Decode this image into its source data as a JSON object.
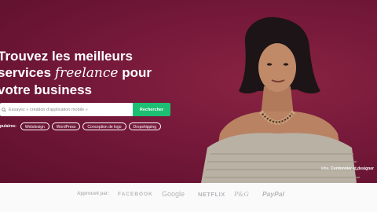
{
  "hero": {
    "title_line1": "Trouvez les meilleurs",
    "title_services": "services",
    "title_italic": "freelance",
    "title_pour": "pour",
    "title_line3": "votre business",
    "background_color": "#76193a"
  },
  "search": {
    "placeholder": "Essayez « création d'application mobile »",
    "button_label": "Rechercher",
    "button_color": "#1dbf73"
  },
  "popular": {
    "label": "pulaires:",
    "chips": [
      "Webdesign",
      "WordPress",
      "Conception de logo",
      "Dropshipping"
    ]
  },
  "caption": {
    "name": "Isha,",
    "role": "Cordonnier et designer"
  },
  "trusted": {
    "label": "Approuvé par:",
    "logos": [
      "FACEBOOK",
      "Google",
      "NETFLIX",
      "P&G",
      "PayPal"
    ]
  }
}
